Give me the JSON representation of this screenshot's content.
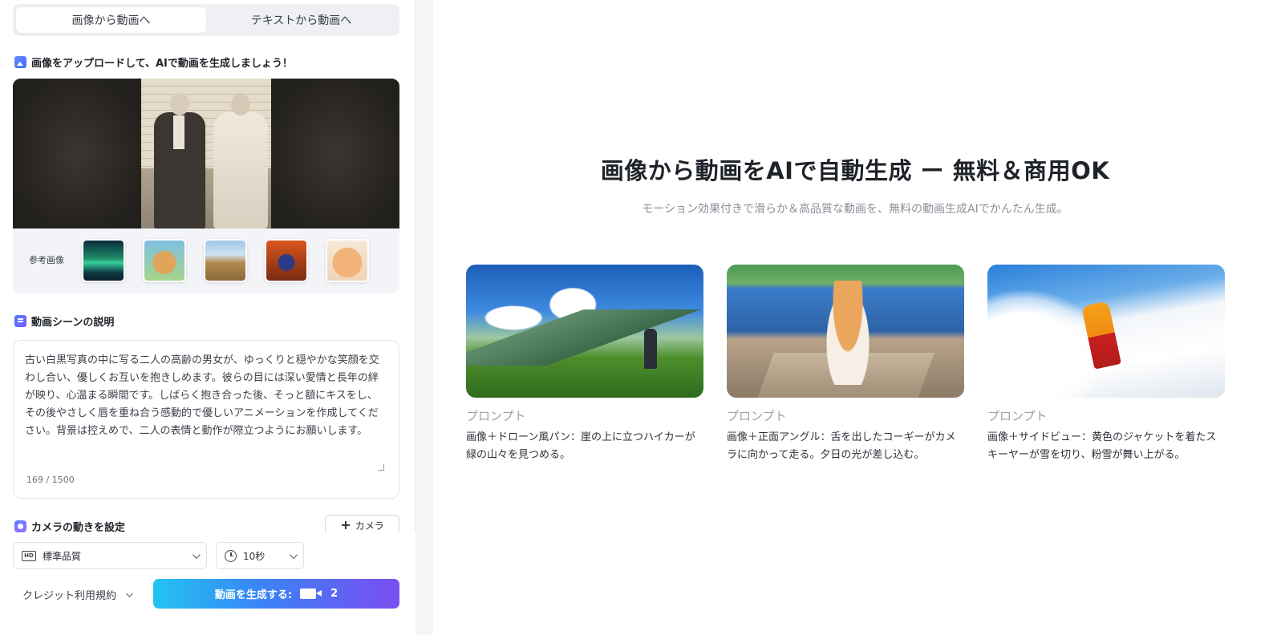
{
  "tabs": [
    {
      "label": "画像から動画へ",
      "active": true
    },
    {
      "label": "テキストから動画へ",
      "active": false
    }
  ],
  "upload": {
    "title": "画像をアップロードして、AIで動画を生成しましょう！",
    "reference_label": "参考画像",
    "reference_thumbs": [
      {
        "name": "aurora"
      },
      {
        "name": "bear-toy"
      },
      {
        "name": "hiker"
      },
      {
        "name": "perfume-bottle"
      },
      {
        "name": "cat"
      }
    ]
  },
  "description": {
    "title": "動画シーンの説明",
    "text": "古い白黒写真の中に写る二人の高齢の男女が、ゆっくりと穏やかな笑顔を交わし合い、優しくお互いを抱きしめます。彼らの目には深い愛情と長年の絆が映り、心温まる瞬間です。しばらく抱き合った後、そっと額にキスをし、その後やさしく唇を重ね合う感動的で優しいアニメーションを作成してください。背景は控えめで、二人の表情と動作が際立つようにお願いします。",
    "counter": "169 / 1500"
  },
  "camera": {
    "title": "カメラの動きを設定",
    "button_label": "カメラ",
    "button_icon": "plus-icon"
  },
  "settings": {
    "quality": "標準品質",
    "quality_icon": "hd-icon",
    "duration": "10秒",
    "duration_icon": "clock-icon"
  },
  "footer": {
    "terms": "クレジット利用規約",
    "generate_label": "動画を生成する:",
    "generate_cost": "2",
    "generate_icon": "video-camera-icon",
    "gradient_colors": [
      "#22c4f3",
      "#3b82f6",
      "#7b4df1"
    ]
  },
  "hero": {
    "title": "画像から動画をAIで自動生成 ー 無料＆商用OK",
    "subtitle": "モーション効果付きで滑らか＆高品質な動画を、無料の動画生成AIでかんたん生成。"
  },
  "examples": [
    {
      "label": "プロンプト",
      "desc": "画像＋ドローン風パン：崖の上に立つハイカーが緑の山々を見つめる。"
    },
    {
      "label": "プロンプト",
      "desc": "画像＋正面アングル：舌を出したコーギーがカメラに向かって走る。夕日の光が差し込む。"
    },
    {
      "label": "プロンプト",
      "desc": "画像＋サイドビュー：黄色のジャケットを着たスキーヤーが雪を切り、粉雪が舞い上がる。"
    }
  ]
}
